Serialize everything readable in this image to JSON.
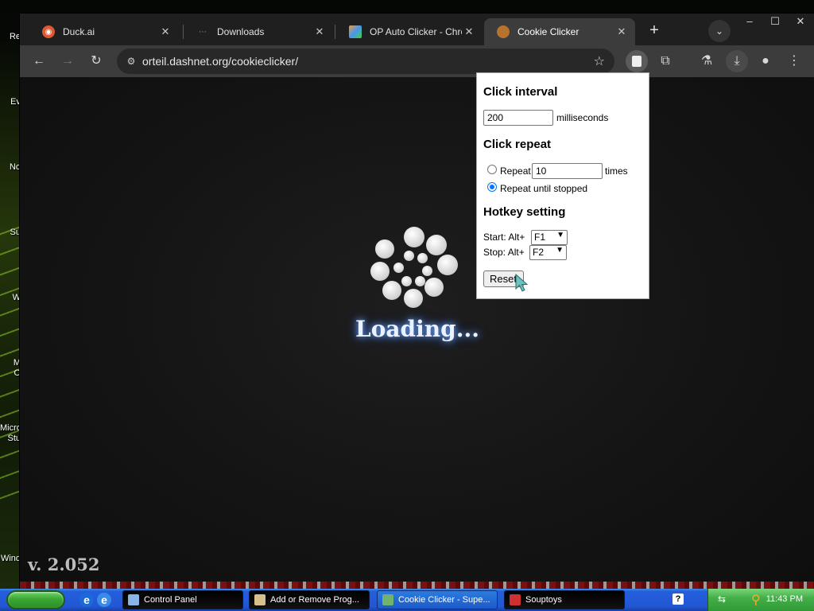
{
  "desktop": {
    "icon_labels": [
      "Re",
      "Ev",
      "No",
      "Su",
      "W",
      "M",
      "O",
      "Micro",
      "Stu",
      "Wind"
    ]
  },
  "browser": {
    "tabs": [
      {
        "title": "Duck.ai",
        "icon": "duckduckgo-icon",
        "active": false
      },
      {
        "title": "Downloads",
        "icon": "downloads-icon",
        "active": false
      },
      {
        "title": "OP Auto Clicker - Chrom",
        "icon": "op-auto-clicker-icon",
        "active": false
      },
      {
        "title": "Cookie Clicker",
        "icon": "cookie-icon",
        "active": true
      }
    ],
    "new_tab_label": "+",
    "address": "orteil.dashnet.org/cookieclicker/",
    "window_controls": {
      "minimize": "–",
      "maximize": "☐",
      "close": "✕"
    }
  },
  "page": {
    "loading_text": "Loading...",
    "version_text": "v. 2.052"
  },
  "popup": {
    "interval_heading": "Click interval",
    "interval_value": "200",
    "interval_unit": "milliseconds",
    "repeat_heading": "Click repeat",
    "repeat_label": "Repeat",
    "repeat_value": "10",
    "repeat_unit": "times",
    "repeat_until_label": "Repeat until stopped",
    "selected_mode": "repeat-until-stopped",
    "hotkey_heading": "Hotkey setting",
    "start_label": "Start: Alt+",
    "start_key": "F1",
    "stop_label": "Stop: Alt+",
    "stop_key": "F2",
    "reset_label": "Reset"
  },
  "taskbar": {
    "buttons": [
      {
        "label": "Control Panel",
        "active": false
      },
      {
        "label": "Add or Remove Prog...",
        "active": false
      },
      {
        "label": "Cookie Clicker - Supe...",
        "active": true
      },
      {
        "label": "Souptoys",
        "active": false
      }
    ],
    "help_label": "?",
    "clock": "11:43 PM"
  },
  "colors": {
    "browser_frame": "#1f1f1f",
    "toolbar": "#3c3c3c",
    "radio_accent": "#0075ff",
    "loading_glow": "#6fa3ff",
    "taskbar_blue": "#245edb",
    "tray_green": "#45b04a"
  }
}
